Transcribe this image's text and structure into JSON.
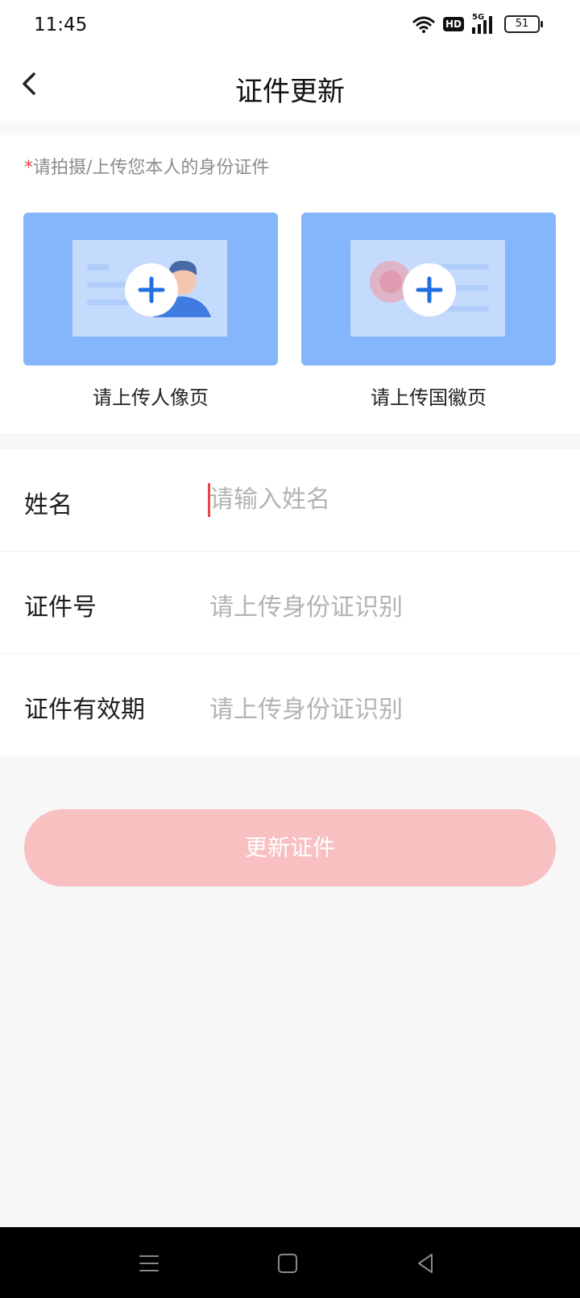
{
  "status_bar": {
    "time": "11:45",
    "hd_label": "HD",
    "network": "5G",
    "battery": "51"
  },
  "header": {
    "title": "证件更新",
    "back_icon": "chevron-left-icon"
  },
  "upload": {
    "required_mark": "*",
    "hint": "请拍摄/上传您本人的身份证件",
    "slots": [
      {
        "label": "请上传人像页",
        "icon": "portrait-page-icon"
      },
      {
        "label": "请上传国徽页",
        "icon": "emblem-page-icon"
      }
    ]
  },
  "form": {
    "name": {
      "label": "姓名",
      "placeholder": "请输入姓名",
      "value": ""
    },
    "id_number": {
      "label": "证件号",
      "value": "请上传身份证识别"
    },
    "validity": {
      "label": "证件有效期",
      "value": "请上传身份证识别"
    }
  },
  "submit": {
    "label": "更新证件"
  },
  "colors": {
    "accent": "#e8444a",
    "button_disabled": "#f9c0c2",
    "upload_bg": "#85b5fa",
    "plus_blue": "#1f6fe0"
  },
  "system_nav": [
    "menu-icon",
    "home-icon",
    "back-triangle-icon"
  ]
}
